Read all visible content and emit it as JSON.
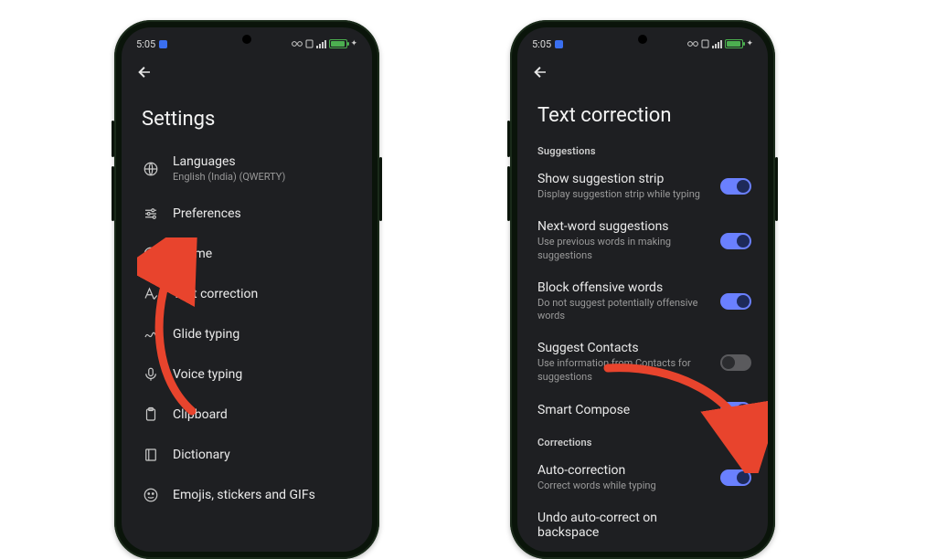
{
  "status": {
    "time": "5:05"
  },
  "left": {
    "title": "Settings",
    "items": [
      {
        "icon": "globe",
        "label": "Languages",
        "sub": "English (India) (QWERTY)"
      },
      {
        "icon": "sliders",
        "label": "Preferences"
      },
      {
        "icon": "palette",
        "label": "Theme"
      },
      {
        "icon": "textA",
        "label": "Text correction"
      },
      {
        "icon": "gesture",
        "label": "Glide typing"
      },
      {
        "icon": "mic",
        "label": "Voice typing"
      },
      {
        "icon": "clipboard",
        "label": "Clipboard"
      },
      {
        "icon": "book",
        "label": "Dictionary"
      },
      {
        "icon": "emoji",
        "label": "Emojis, stickers and GIFs"
      }
    ]
  },
  "right": {
    "title": "Text correction",
    "sections": [
      {
        "header": "Suggestions",
        "items": [
          {
            "label": "Show suggestion strip",
            "sub": "Display suggestion strip while typing",
            "on": true
          },
          {
            "label": "Next-word suggestions",
            "sub": "Use previous words in making suggestions",
            "on": true
          },
          {
            "label": "Block offensive words",
            "sub": "Do not suggest potentially offensive words",
            "on": true
          },
          {
            "label": "Suggest Contacts",
            "sub": "Use information from Contacts for suggestions",
            "on": false
          },
          {
            "label": "Smart Compose",
            "sub": "",
            "on": true
          }
        ]
      },
      {
        "header": "Corrections",
        "items": [
          {
            "label": "Auto-correction",
            "sub": "Correct words while typing",
            "on": true
          },
          {
            "label": "Undo auto-correct on backspace",
            "sub": "",
            "on": null
          }
        ]
      }
    ]
  }
}
